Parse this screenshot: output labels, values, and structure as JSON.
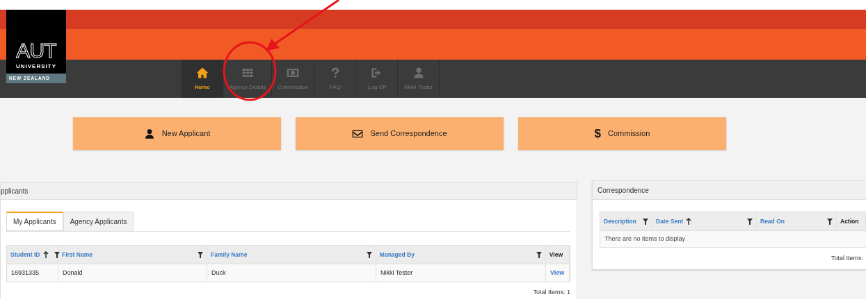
{
  "logo": {
    "mark": "AUT",
    "line1": "UNIVERSITY",
    "line2": "NEW ZEALAND"
  },
  "nav": [
    {
      "label": "Home",
      "kind": "home",
      "selected": true
    },
    {
      "label": "Agency Details",
      "kind": "grid",
      "selected": false
    },
    {
      "label": "Commission",
      "kind": "money",
      "selected": false
    },
    {
      "label": "FAQ",
      "kind": "question",
      "selected": false
    },
    {
      "label": "Log Off",
      "kind": "logoff",
      "selected": false
    },
    {
      "label": "Nikki Tester",
      "kind": "user",
      "selected": false
    }
  ],
  "actions": [
    {
      "label": "New Applicant",
      "kind": "user"
    },
    {
      "label": "Send Correspondence",
      "kind": "mail"
    },
    {
      "label": "Commission",
      "kind": "dollar",
      "symbol": "$"
    }
  ],
  "applicants": {
    "title": "pplicants",
    "tabs": [
      {
        "label": "My Applicants",
        "selected": true
      },
      {
        "label": "Agency Applicants",
        "selected": false
      }
    ],
    "columns": [
      {
        "label": "Student ID",
        "sorted": true,
        "filter": true
      },
      {
        "label": "First Name",
        "sorted": false,
        "filter": true
      },
      {
        "label": "Family Name",
        "sorted": false,
        "filter": true
      },
      {
        "label": "Managed By",
        "sorted": false,
        "filter": true
      },
      {
        "label": "View",
        "sorted": false,
        "filter": false
      }
    ],
    "rows": [
      [
        "16931335",
        "Donald",
        "Duck",
        "Nikki Tester",
        "View"
      ]
    ],
    "total": "Total Items: 1"
  },
  "correspondence": {
    "title": "Correspondence",
    "columns": [
      {
        "label": "Description",
        "sorted": false,
        "filter": true
      },
      {
        "label": "Date Sent",
        "sorted": true,
        "filter": true
      },
      {
        "label": "Read On",
        "sorted": false,
        "filter": true
      },
      {
        "label": "Action",
        "sorted": false,
        "filter": false
      }
    ],
    "empty": "There are no items to display",
    "total": "Total Items:"
  }
}
